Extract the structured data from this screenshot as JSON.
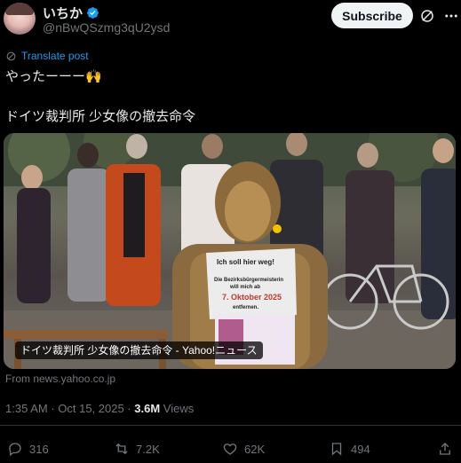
{
  "author": {
    "display_name": "いちか",
    "handle": "@nBwQSzmg3qU2ysd",
    "subscribe_label": "Subscribe"
  },
  "post": {
    "translate_label": "Translate post",
    "line1": "やったーーー🙌",
    "line2": "ドイツ裁判所 少女像の撤去命令"
  },
  "media": {
    "caption": "ドイツ裁判所 少女像の撤去命令 - Yahoo!ニュース",
    "sign_lines": [
      "Ich soll hier weg!",
      "Die Bezirksbürgermeisterin",
      "will mich ab",
      "7. Oktober 2025",
      "entfernen."
    ]
  },
  "source": "From news.yahoo.co.jp",
  "meta": {
    "timestamp": "1:35 AM · Oct 15, 2025 · ",
    "views_count": "3.6M",
    "views_label": " Views"
  },
  "actions": {
    "replies": "316",
    "reposts": "7.2K",
    "likes": "62K",
    "bookmarks": "494"
  },
  "colors": {
    "background": "#000000",
    "accent": "#1d9bf0",
    "muted": "#71767b",
    "text": "#e7e9ea"
  }
}
